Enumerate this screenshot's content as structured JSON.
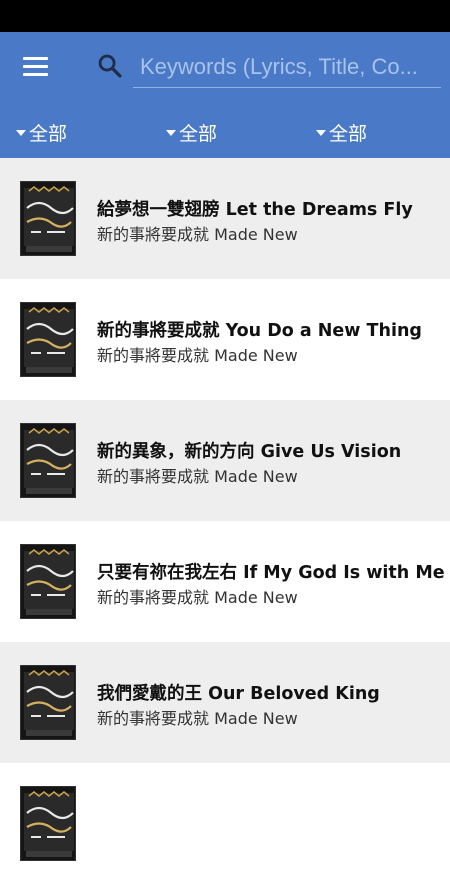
{
  "search": {
    "placeholder": "Keywords (Lyrics, Title, Co..."
  },
  "filters": [
    {
      "label": "全部"
    },
    {
      "label": "全部"
    },
    {
      "label": "全部"
    }
  ],
  "songs": [
    {
      "title": "給夢想一雙翅膀 Let the Dreams Fly",
      "album": "新的事將要成就 Made New"
    },
    {
      "title": "新的事將要成就 You Do a New Thing",
      "album": "新的事將要成就 Made New"
    },
    {
      "title": "新的異象，新的方向 Give Us Vision",
      "album": "新的事將要成就 Made New"
    },
    {
      "title": "只要有祢在我左右 If My God Is with Me",
      "album": "新的事將要成就 Made New"
    },
    {
      "title": "我們愛戴的王 Our Beloved King",
      "album": "新的事將要成就 Made New"
    },
    {
      "title": "",
      "album": ""
    }
  ],
  "colors": {
    "app_bar": "#4a7ac7",
    "row_alt": "#eeeeee",
    "status_bar": "#000000"
  }
}
